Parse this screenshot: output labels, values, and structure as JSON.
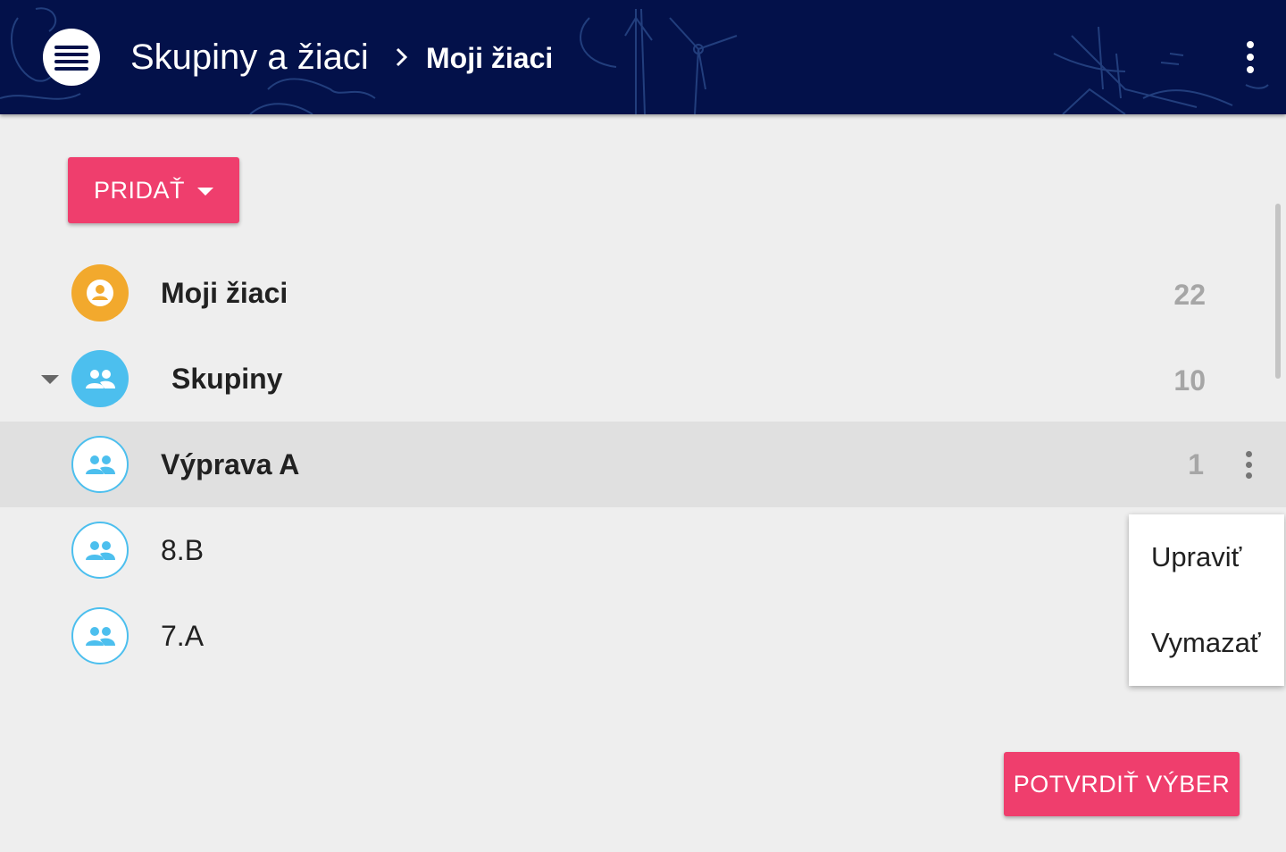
{
  "header": {
    "breadcrumb_root": "Skupiny a žiaci",
    "breadcrumb_current": "Moji žiaci",
    "background_color": "#03114a"
  },
  "toolbar": {
    "add_label": "PRIDAŤ"
  },
  "tree": {
    "items": [
      {
        "label": "Moji žiaci",
        "count": "22",
        "icon": "person-icon"
      },
      {
        "label": "Skupiny",
        "count": "10",
        "icon": "group-icon",
        "expanded": true
      },
      {
        "label": "Výprava A",
        "count": "1",
        "icon": "group-icon",
        "selected": true
      },
      {
        "label": "8.B",
        "count": "",
        "icon": "group-icon"
      },
      {
        "label": "7.A",
        "count": "",
        "icon": "group-icon"
      }
    ]
  },
  "context_menu": {
    "items": [
      {
        "label": "Upraviť"
      },
      {
        "label": "Vymazať"
      }
    ]
  },
  "footer": {
    "confirm_label": "POTVRDIŤ VÝBER"
  },
  "colors": {
    "accent": "#ef3e6d",
    "my_students_avatar": "#f2a92d",
    "group_avatar": "#4cbfee",
    "count_text": "#a6a6a6",
    "selected_row": "#e0e0e0"
  }
}
